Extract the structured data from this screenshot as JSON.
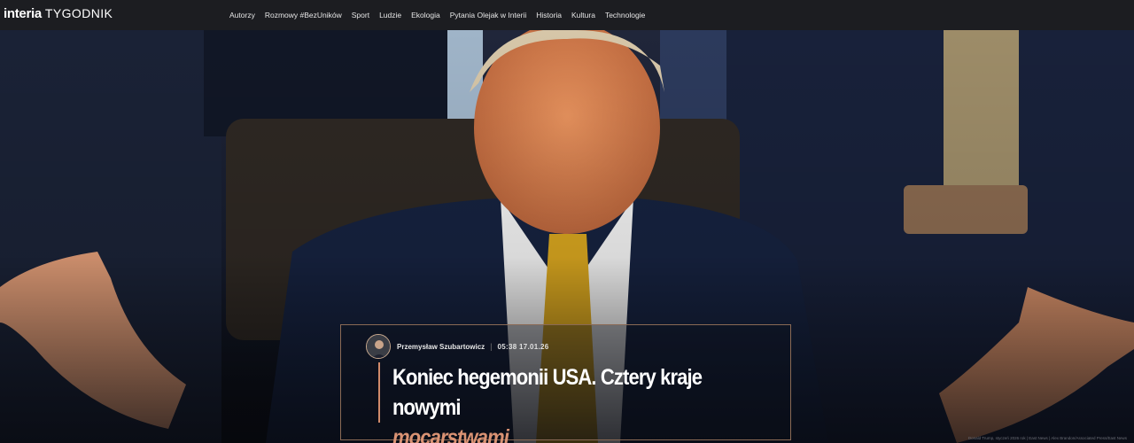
{
  "header": {
    "logo_brand": "interia",
    "logo_sub": "TYGODNIK",
    "nav": [
      "Autorzy",
      "Rozmowy #BezUników",
      "Sport",
      "Ludzie",
      "Ekologia",
      "Pytania Olejak w Interii",
      "Historia",
      "Kultura",
      "Technologie"
    ]
  },
  "article": {
    "author": "Przemysław Szubartowicz",
    "date": "05:38 17.01.26",
    "title": "Koniec hegemonii USA. Cztery kraje nowymi",
    "title_accent": "mocarstwami"
  },
  "photo_credit": "Donald Trump, styczeń 2026 rok | East News | Alex Brandon/Associated Press/East News",
  "colors": {
    "accent": "#d99273",
    "topbar": "#1c1d21"
  }
}
